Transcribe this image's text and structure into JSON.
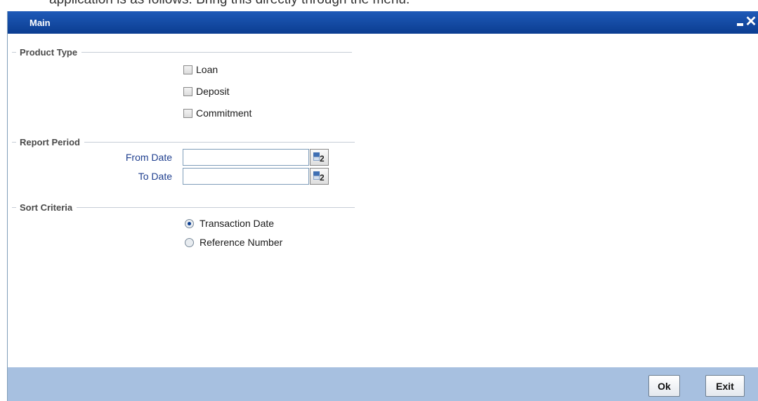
{
  "partial_text_top": "application is as follows. Bring this directly through the menu.",
  "window": {
    "title": "Main"
  },
  "product_type": {
    "header": "Product Type",
    "options": [
      {
        "label": "Loan",
        "checked": false
      },
      {
        "label": "Deposit",
        "checked": false
      },
      {
        "label": "Commitment",
        "checked": false
      }
    ]
  },
  "report_period": {
    "header": "Report Period",
    "from_date_label": "From Date",
    "from_date_value": "",
    "to_date_label": "To Date",
    "to_date_value": "",
    "calendar_glyph": "2"
  },
  "sort_criteria": {
    "header": "Sort Criteria",
    "options": [
      {
        "label": "Transaction Date",
        "selected": true
      },
      {
        "label": "Reference Number",
        "selected": false
      }
    ]
  },
  "footer": {
    "ok_label": "Ok",
    "exit_label": "Exit"
  },
  "colors": {
    "title_bar": "#0b3d91",
    "footer": "#a7c0e0",
    "field_label": "#1f3f8f"
  },
  "icons": [
    "minimize-icon",
    "close-icon",
    "calendar-icon"
  ]
}
